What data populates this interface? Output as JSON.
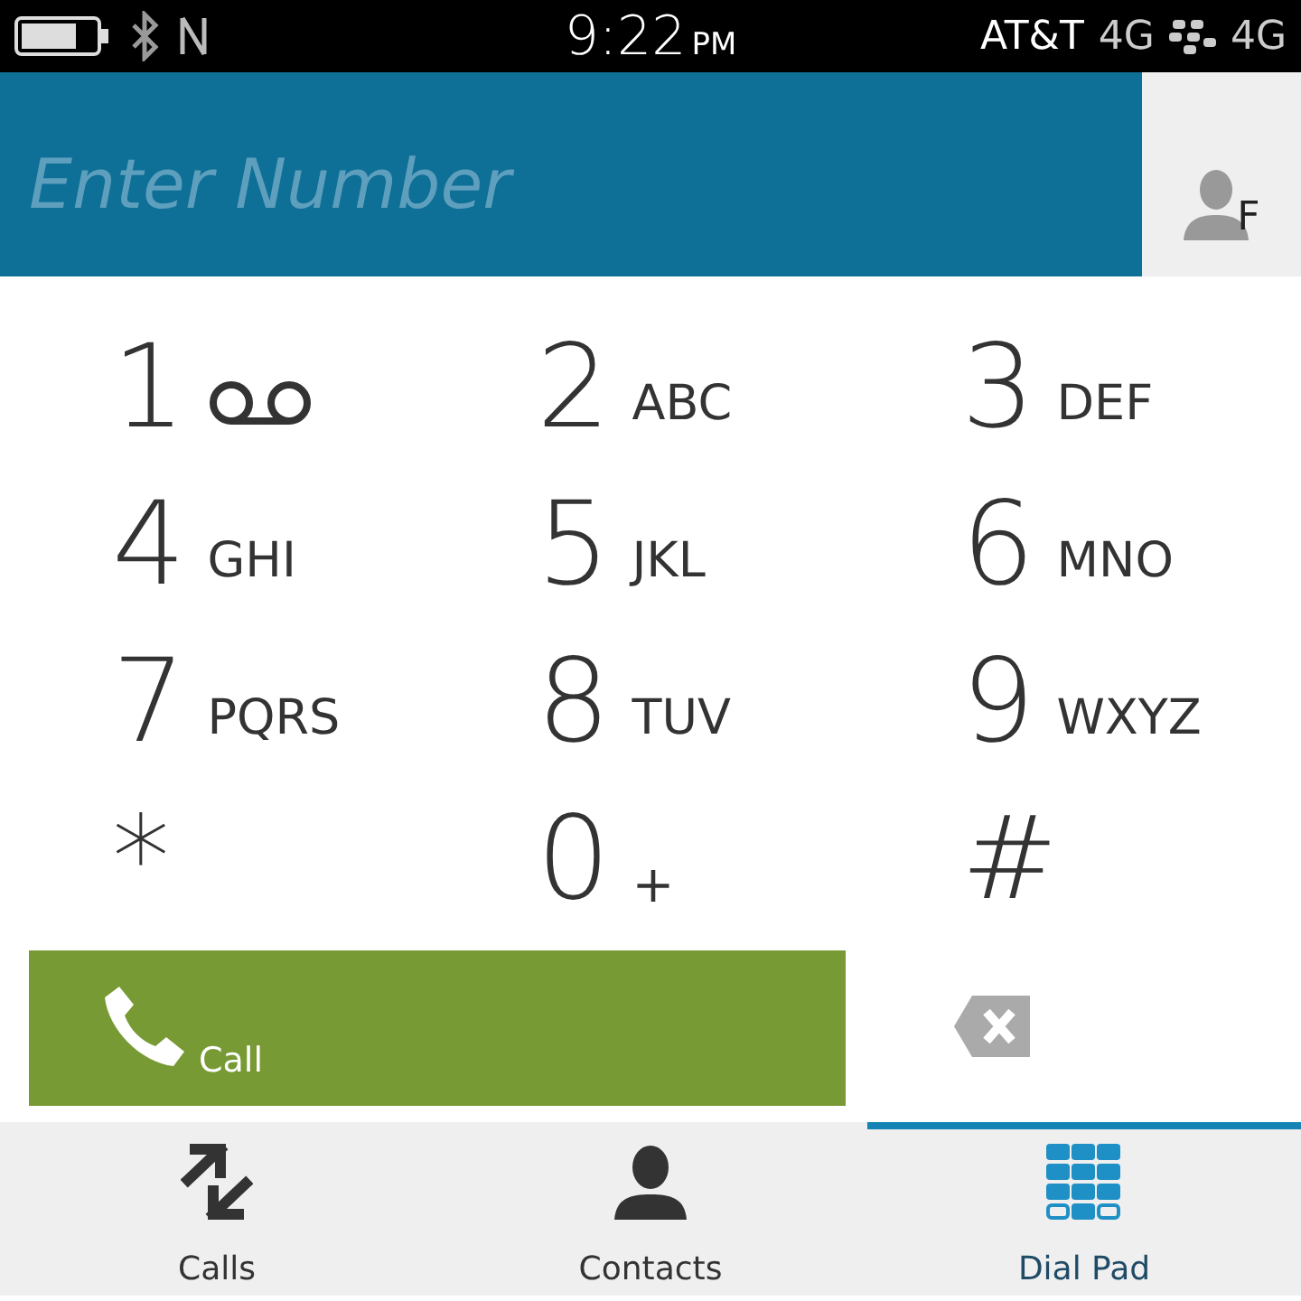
{
  "status_bar": {
    "time": "9:22",
    "ampm": "PM",
    "carrier": "AT&T",
    "network": "4G",
    "network_2": "4G"
  },
  "number_field": {
    "placeholder": "Enter Number"
  },
  "contact_hint": {
    "letter": "F"
  },
  "keys": [
    {
      "digit": "1",
      "kind": "voicemail"
    },
    {
      "digit": "2",
      "kind": "letters",
      "letters": "ABC"
    },
    {
      "digit": "3",
      "kind": "letters",
      "letters": "DEF"
    },
    {
      "digit": "4",
      "kind": "letters",
      "letters": "GHI"
    },
    {
      "digit": "5",
      "kind": "letters",
      "letters": "JKL"
    },
    {
      "digit": "6",
      "kind": "letters",
      "letters": "MNO"
    },
    {
      "digit": "7",
      "kind": "letters",
      "letters": "PQRS"
    },
    {
      "digit": "8",
      "kind": "letters",
      "letters": "TUV"
    },
    {
      "digit": "9",
      "kind": "letters",
      "letters": "WXYZ"
    },
    {
      "digit": "*",
      "kind": "symbol"
    },
    {
      "digit": "0",
      "kind": "plus",
      "letters": "+"
    },
    {
      "digit": "#",
      "kind": "symbol"
    }
  ],
  "call_button": {
    "label": "Call"
  },
  "tabs": [
    {
      "label": "Calls",
      "kind": "calls",
      "selected": false
    },
    {
      "label": "Contacts",
      "kind": "contacts",
      "selected": false
    },
    {
      "label": "Dial Pad",
      "kind": "dialpad",
      "selected": true
    }
  ]
}
